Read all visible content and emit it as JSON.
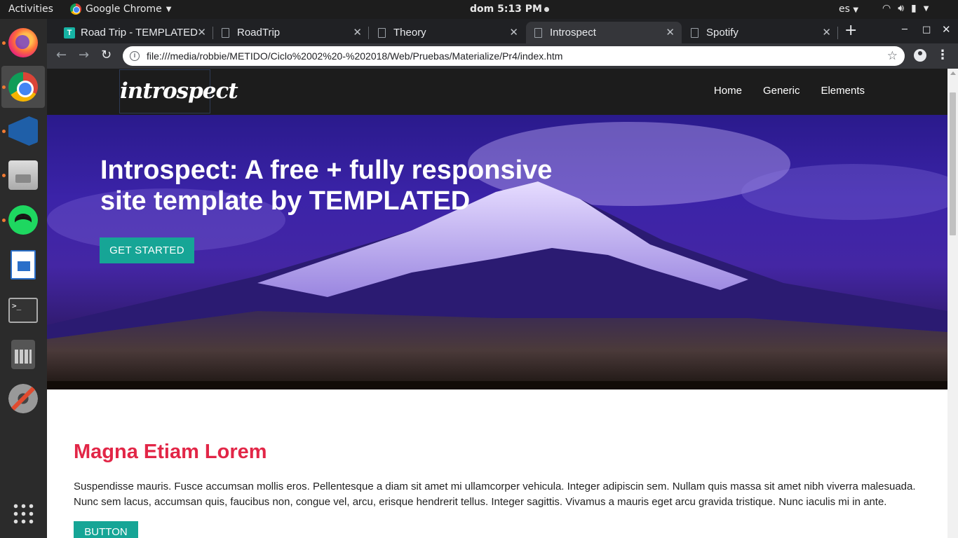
{
  "system_bar": {
    "activities": "Activities",
    "app_name": "Google Chrome",
    "clock": "dom 5:13 PM",
    "language": "es"
  },
  "dock": {
    "apps": [
      "Firefox",
      "Google Chrome",
      "Visual Studio Code",
      "Files",
      "Spotify",
      "LibreOffice Writer",
      "Terminal",
      "Calculator",
      "Settings"
    ]
  },
  "browser": {
    "tabs": [
      {
        "label": "Road Trip - TEMPLATED",
        "favicon": "T"
      },
      {
        "label": "RoadTrip",
        "favicon": "page-icon"
      },
      {
        "label": "Theory",
        "favicon": "page-icon"
      },
      {
        "label": "Introspect",
        "favicon": "page-icon"
      },
      {
        "label": "Spotify",
        "favicon": "page-icon"
      }
    ],
    "active_tab": 3,
    "url": "file:///media/robbie/METIDO/Ciclo%2002%20-%202018/Web/Pruebas/Materialize/Pr4/index.htm"
  },
  "site": {
    "logo": "introspect",
    "nav": [
      "Home",
      "Generic",
      "Elements"
    ],
    "banner": {
      "heading": "Introspect: A free + fully responsive site template by TEMPLATED",
      "button": "GET STARTED"
    },
    "section": {
      "heading": "Magna Etiam Lorem",
      "body": "Suspendisse mauris. Fusce accumsan mollis eros. Pellentesque a diam sit amet mi ullamcorper vehicula. Integer adipiscin sem. Nullam quis massa sit amet nibh viverra malesuada. Nunc sem lacus, accumsan quis, faucibus non, congue vel, arcu, erisque hendrerit tellus. Integer sagittis. Vivamus a mauris eget arcu gravida tristique. Nunc iaculis mi in ante.",
      "button": "BUTTON"
    }
  },
  "colors": {
    "accent_teal": "#16a596",
    "heading_red": "#e22647",
    "header_dark": "#1c1c1c"
  }
}
